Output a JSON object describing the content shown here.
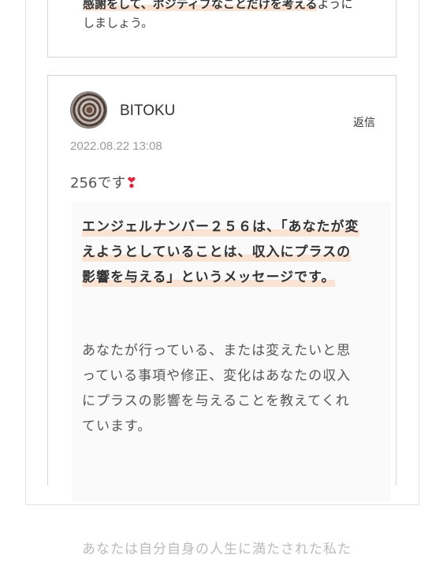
{
  "previous_comment": {
    "line1_highlight": "感謝をして、ポジティブなことだけを考える",
    "line1_rest": "ように",
    "line2": "しましょう。"
  },
  "comment": {
    "author": "BITOKU",
    "reply_label": "返信",
    "date": "2022.08.22 13:08",
    "text": "256です",
    "emoji": "❣",
    "quote": {
      "bold_paragraph": "エンジェルナンバー２５６は、「あなたが変えようとしていることは、収入にプラスの影響を与える」というメッセージです。",
      "normal_paragraph": "あなたが行っている、または変えたいと思っている事項や修正、変化はあなたの収入にプラスの影響を与えることを教えてくれています。",
      "faded_paragraph": "あなたは自分自身の人生に満たされた私た"
    }
  }
}
